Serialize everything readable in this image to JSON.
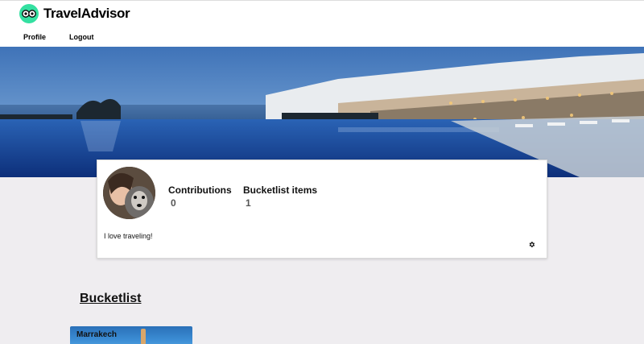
{
  "app": {
    "brand": "TravelAdvisor",
    "logo_icon": "owl-eyes-icon",
    "accent": "#34e0a1"
  },
  "nav": {
    "items": [
      {
        "label": "Profile"
      },
      {
        "label": "Logout"
      }
    ]
  },
  "profile": {
    "avatar_icon": "avatar",
    "stats": [
      {
        "label": "Contributions",
        "value": "0"
      },
      {
        "label": "Bucketlist items",
        "value": "1"
      }
    ],
    "bio": "I love traveling!",
    "settings_icon": "gear-icon"
  },
  "bucketlist": {
    "title": "Bucketlist",
    "items": [
      {
        "label": "Marrakech"
      }
    ]
  }
}
